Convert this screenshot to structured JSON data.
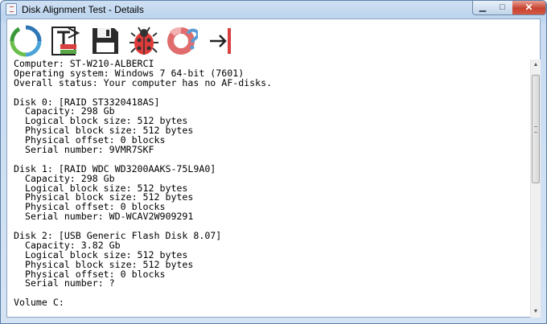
{
  "window": {
    "title": "Disk Alignment Test - Details",
    "controls": {
      "minimize": "▁",
      "maximize": "□",
      "close": "✕"
    }
  },
  "toolbar": {
    "buttons": [
      {
        "icon": "refresh-icon"
      },
      {
        "icon": "text-report-icon"
      },
      {
        "icon": "save-icon"
      },
      {
        "icon": "bug-icon"
      },
      {
        "icon": "help-icon"
      },
      {
        "icon": "exit-icon"
      }
    ]
  },
  "details": {
    "lines": [
      "Computer: ST-W210-ALBERCI",
      "Operating system: Windows 7 64-bit (7601)",
      "Overall status: Your computer has no AF-disks.",
      "",
      "Disk 0: [RAID ST3320418AS]",
      "  Capacity: 298 Gb",
      "  Logical block size: 512 bytes",
      "  Physical block size: 512 bytes",
      "  Physical offset: 0 blocks",
      "  Serial number: 9VMR7SKF",
      "",
      "Disk 1: [RAID WDC WD3200AAKS-75L9A0]",
      "  Capacity: 298 Gb",
      "  Logical block size: 512 bytes",
      "  Physical block size: 512 bytes",
      "  Physical offset: 0 blocks",
      "  Serial number: WD-WCAV2W909291",
      "",
      "Disk 2: [USB Generic Flash Disk 8.07]",
      "  Capacity: 3.82 Gb",
      "  Logical block size: 512 bytes",
      "  Physical block size: 512 bytes",
      "  Physical offset: 0 blocks",
      "  Serial number: ?",
      "",
      "Volume C:"
    ]
  },
  "scrollbar": {
    "up": "▲",
    "down": "▼"
  }
}
